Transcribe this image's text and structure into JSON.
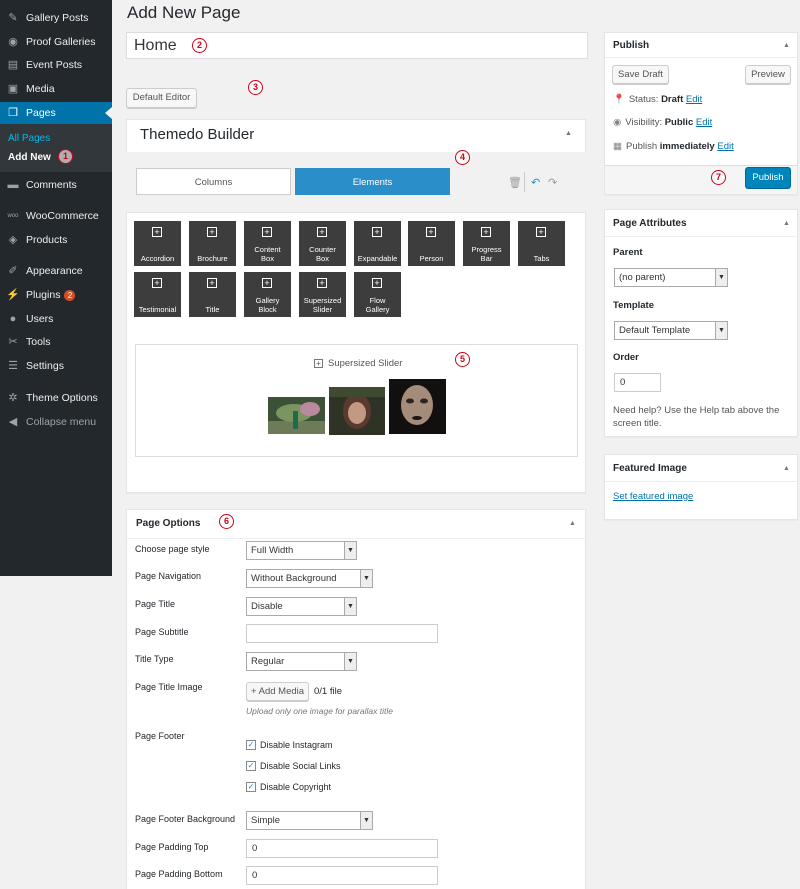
{
  "sidebar": {
    "items": [
      {
        "icon": "pushpin-icon",
        "label": "Gallery Posts"
      },
      {
        "icon": "eye-icon",
        "label": "Proof Galleries"
      },
      {
        "icon": "calendar-icon",
        "label": "Event Posts"
      },
      {
        "icon": "media-icon",
        "label": "Media"
      },
      {
        "icon": "pages-icon",
        "label": "Pages"
      },
      {
        "icon": "comments-icon",
        "label": "Comments"
      },
      {
        "icon": "woocommerce-icon",
        "label": "WooCommerce"
      },
      {
        "icon": "products-icon",
        "label": "Products"
      },
      {
        "icon": "appearance-icon",
        "label": "Appearance"
      },
      {
        "icon": "plugins-icon",
        "label": "Plugins"
      },
      {
        "icon": "users-icon",
        "label": "Users"
      },
      {
        "icon": "tools-icon",
        "label": "Tools"
      },
      {
        "icon": "settings-icon",
        "label": "Settings"
      },
      {
        "icon": "gear-icon",
        "label": "Theme Options"
      },
      {
        "icon": "collapse-icon",
        "label": "Collapse menu"
      }
    ],
    "submenu": {
      "all_pages": "All Pages",
      "add_new": "Add New"
    },
    "plugins_badge": "2"
  },
  "callouts": [
    "1",
    "2",
    "3",
    "4",
    "5",
    "6",
    "7"
  ],
  "page": {
    "title": "Add New Page",
    "post_title": "Home",
    "default_editor_label": "Default Editor"
  },
  "builder": {
    "title": "Themedo Builder",
    "tabs": {
      "columns": "Columns",
      "elements": "Elements"
    },
    "elements": [
      [
        "Accordion"
      ],
      [
        "Brochure"
      ],
      [
        "Content",
        "Box"
      ],
      [
        "Counter",
        "Box"
      ],
      [
        "Expandable"
      ],
      [
        "Person"
      ],
      [
        "Progress",
        "Bar"
      ],
      [
        "Tabs"
      ],
      [
        "Testimonial"
      ],
      [
        "Title"
      ],
      [
        "Gallery",
        "Block"
      ],
      [
        "Supersized",
        "Slider"
      ],
      [
        "Flow",
        "Gallery"
      ]
    ],
    "slider_label": "Supersized Slider"
  },
  "page_options": {
    "title": "Page Options",
    "choose_style": {
      "label": "Choose page style",
      "value": "Full Width"
    },
    "navigation": {
      "label": "Page Navigation",
      "value": "Without Background"
    },
    "page_title": {
      "label": "Page Title",
      "value": "Disable"
    },
    "subtitle": {
      "label": "Page Subtitle",
      "value": ""
    },
    "title_type": {
      "label": "Title Type",
      "value": "Regular"
    },
    "title_image": {
      "label": "Page Title Image",
      "button": "+ Add Media",
      "count": "0/1 file",
      "hint": "Upload only one image for parallax title"
    },
    "footer": {
      "label": "Page Footer",
      "options": [
        "Disable Instagram",
        "Disable Social Links",
        "Disable Copyright"
      ]
    },
    "footer_bg": {
      "label": "Page Footer Background",
      "value": "Simple"
    },
    "padding_top": {
      "label": "Page Padding Top",
      "value": "0"
    },
    "padding_bottom": {
      "label": "Page Padding Bottom",
      "value": "0"
    }
  },
  "publish": {
    "title": "Publish",
    "save_draft": "Save Draft",
    "preview": "Preview",
    "status_label": "Status:",
    "status_value": "Draft",
    "visibility_label": "Visibility:",
    "visibility_value": "Public",
    "publish_label": "Publish",
    "publish_value": "immediately",
    "edit": "Edit",
    "publish_button": "Publish"
  },
  "attributes": {
    "title": "Page Attributes",
    "parent_label": "Parent",
    "parent_value": "(no parent)",
    "template_label": "Template",
    "template_value": "Default Template",
    "order_label": "Order",
    "order_value": "0",
    "help": [
      "Need help? Use the Help tab above the",
      "screen title."
    ]
  },
  "featured": {
    "title": "Featured Image",
    "link": "Set featured image"
  }
}
